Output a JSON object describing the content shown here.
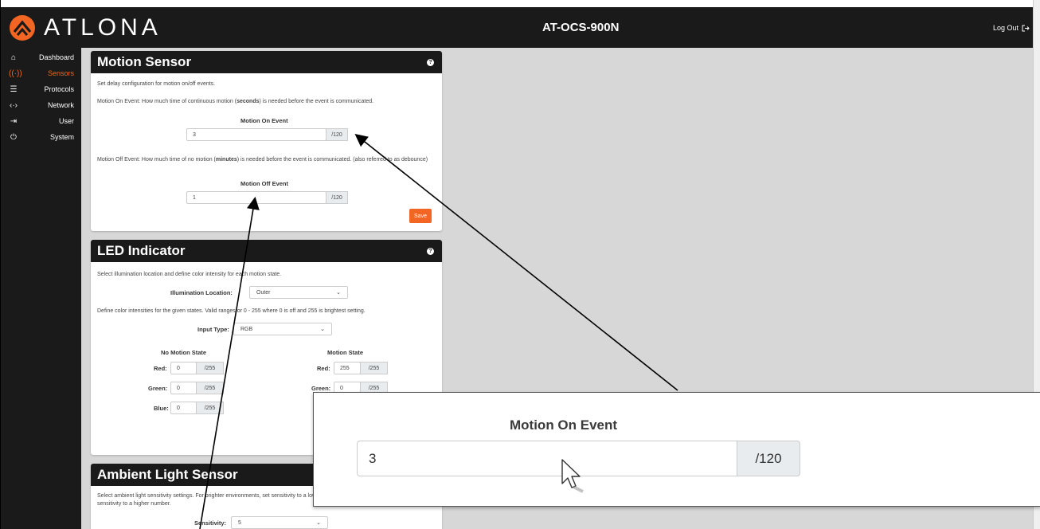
{
  "header": {
    "logo_text": "ATLONA",
    "device": "AT-OCS-900N",
    "logout_label": "Log Out"
  },
  "sidebar": {
    "items": [
      {
        "label": "Dashboard",
        "icon": "home-icon"
      },
      {
        "label": "Sensors",
        "icon": "sensor-icon"
      },
      {
        "label": "Protocols",
        "icon": "server-icon"
      },
      {
        "label": "Network",
        "icon": "network-icon"
      },
      {
        "label": "User",
        "icon": "login-icon"
      },
      {
        "label": "System",
        "icon": "plug-icon"
      }
    ]
  },
  "motion": {
    "title": "Motion Sensor",
    "desc": "Set delay configuration for motion on/off events.",
    "on_desc_pre": "Motion On Event: How much time of continuous motion (",
    "on_desc_bold": "seconds",
    "on_desc_post": ") is needed before the event is communicated.",
    "on_label": "Motion On Event",
    "on_value": "3",
    "on_max": "/120",
    "off_desc_pre": "Motion Off Event: How much time of no motion (",
    "off_desc_bold": "minutes",
    "off_desc_post": ") is needed before the event is communicated. (also referred to as debounce)",
    "off_label": "Motion Off Event",
    "off_value": "1",
    "off_max": "/120",
    "save_label": "Save"
  },
  "led": {
    "title": "LED Indicator",
    "desc": "Select illumination location and define color intensity for each motion state.",
    "location_label": "Illumination Location:",
    "location_value": "Outer",
    "ranges_desc": "Define color intensities for the given states. Valid ranges or 0 - 255 where 0 is off and 255 is brightest setting.",
    "input_type_label": "Input Type:",
    "input_type_value": "RGB",
    "no_motion_title": "No Motion State",
    "motion_title": "Motion State",
    "red_label": "Red:",
    "green_label": "Green:",
    "blue_label": "Blue:",
    "no_red": "0",
    "no_green": "0",
    "no_blue": "0",
    "mo_red": "255",
    "mo_green": "0",
    "max": "/255"
  },
  "ambient": {
    "title": "Ambient Light Sensor",
    "desc": "Select ambient light sensitivity settings. For brighter environments, set sensitivity to a lower number. For darker environments, set sensitivity to a higher number.",
    "sensitivity_label": "Sensitivity:",
    "sensitivity_value": "5"
  },
  "zoom": {
    "label": "Motion On Event",
    "value": "3",
    "max": "/120"
  }
}
